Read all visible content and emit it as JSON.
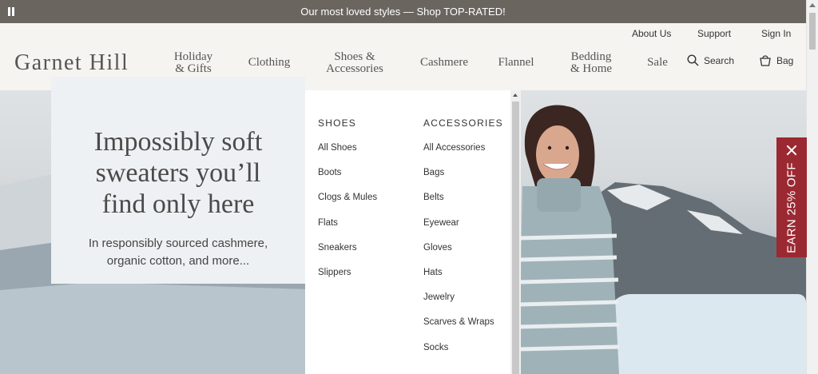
{
  "promo": {
    "text": "Our most loved styles — Shop TOP-RATED!",
    "pause_icon": "pause-icon"
  },
  "utility": {
    "about": "About Us",
    "support": "Support",
    "signin": "Sign In"
  },
  "logo": "Garnet Hill",
  "nav": {
    "holiday": [
      "Holiday",
      "& Gifts"
    ],
    "clothing": "Clothing",
    "shoes": [
      "Shoes &",
      "Accessories"
    ],
    "cashmere": "Cashmere",
    "flannel": "Flannel",
    "bedding": [
      "Bedding",
      "& Home"
    ],
    "sale": "Sale"
  },
  "search": {
    "label": "Search",
    "icon": "search-icon"
  },
  "bag": {
    "label": "Bag",
    "icon": "bag-icon"
  },
  "dropdown": {
    "shoes": {
      "heading": "SHOES",
      "items": [
        "All Shoes",
        "Boots",
        "Clogs & Mules",
        "Flats",
        "Sneakers",
        "Slippers"
      ]
    },
    "accessories": {
      "heading": "ACCESSORIES",
      "items": [
        "All Accessories",
        "Bags",
        "Belts",
        "Eyewear",
        "Gloves",
        "Hats",
        "Jewelry",
        "Scarves & Wraps",
        "Socks"
      ]
    }
  },
  "hero": {
    "title": [
      "Impossibly soft",
      "sweaters you’ll",
      "find only here"
    ],
    "subtitle": [
      "In responsibly sourced cashmere,",
      "organic cotton, and more..."
    ]
  },
  "earn_tab": {
    "text": "EARN 25% OFF",
    "close_icon": "close-icon"
  },
  "colors": {
    "promo_bg": "#6b6560",
    "accent": "#9b2932",
    "page_bg": "#f6f4f1"
  }
}
